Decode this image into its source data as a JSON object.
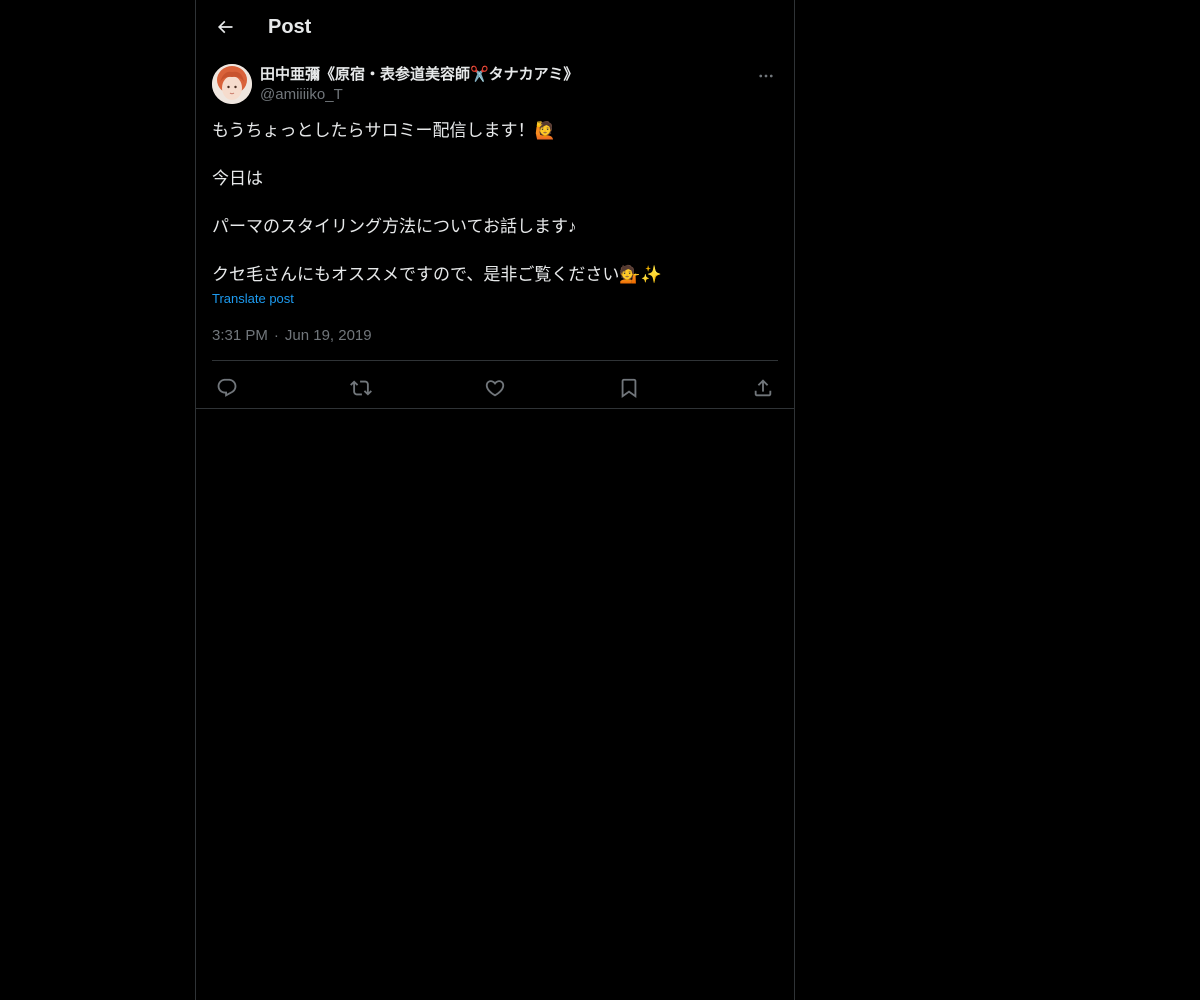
{
  "header": {
    "title": "Post",
    "back_icon": "arrow-left-icon"
  },
  "post": {
    "author": {
      "display_name": "田中亜彌《原宿・表参道美容師✂️タナカアミ》",
      "handle": "@amiiiiko_T"
    },
    "paragraphs": [
      "もうちょっとしたらサロミー配信します！🙋",
      "今日は",
      "パーマのスタイリング方法についてお話します♪",
      "クセ毛さんにもオススメですので、是非ご覧ください💁✨"
    ],
    "translate_label": "Translate post",
    "time": "3:31 PM",
    "separator": "·",
    "date": "Jun 19, 2019",
    "actions": [
      "reply-icon",
      "repost-icon",
      "like-icon",
      "bookmark-icon",
      "share-icon"
    ]
  },
  "colors": {
    "background": "#000000",
    "text_primary": "#e7e9ea",
    "text_secondary": "#71767b",
    "link": "#1d9bf0",
    "border": "#2f3336"
  }
}
